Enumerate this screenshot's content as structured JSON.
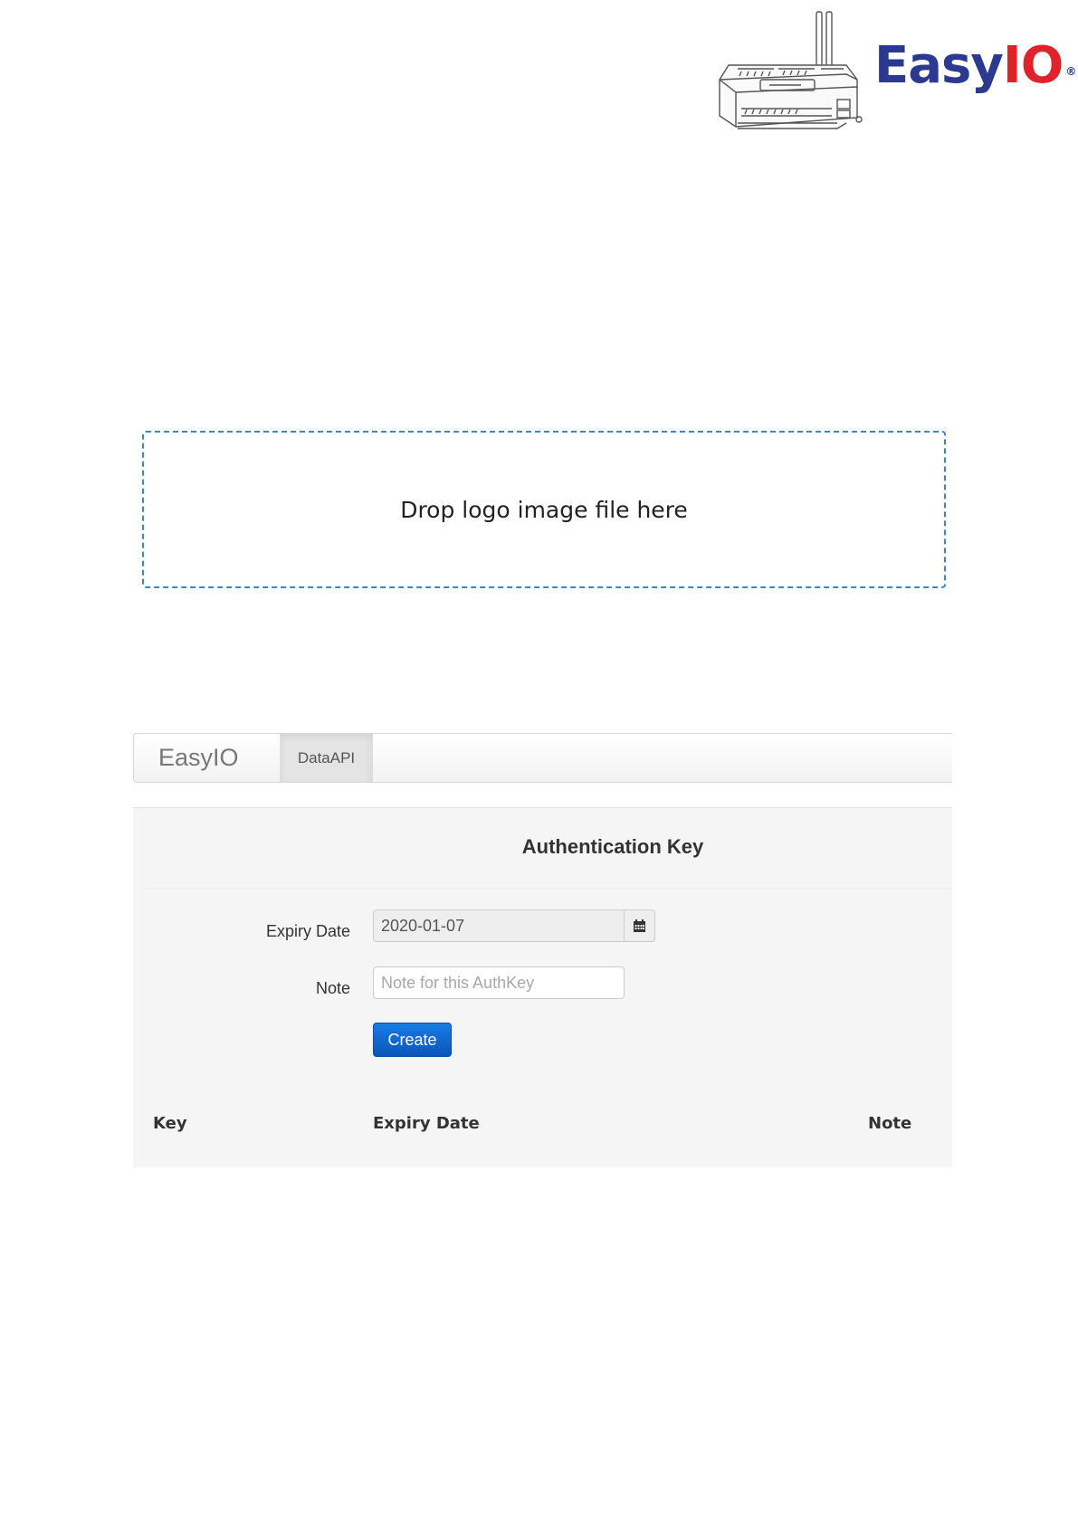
{
  "header": {
    "brand_main": "Easy",
    "brand_accent": "IO",
    "registered_mark": "®",
    "brand_colors": {
      "primary": "#2b3990",
      "accent": "#e0232a"
    }
  },
  "dropzone": {
    "text": "Drop logo image file here",
    "border_color": "#3a86c8"
  },
  "navbar": {
    "brand": "EasyIO",
    "tabs": [
      {
        "label": "DataAPI",
        "active": true
      }
    ]
  },
  "auth_panel": {
    "title": "Authentication Key",
    "expiry_label": "Expiry Date",
    "expiry_value": "2020-01-07",
    "calendar_icon": "calendar-icon",
    "note_label": "Note",
    "note_placeholder": "Note for this AuthKey",
    "note_value": "",
    "create_label": "Create",
    "button_color": "#1a6fd6"
  },
  "table": {
    "columns": [
      "Key",
      "Expiry Date",
      "Note"
    ],
    "rows": []
  }
}
